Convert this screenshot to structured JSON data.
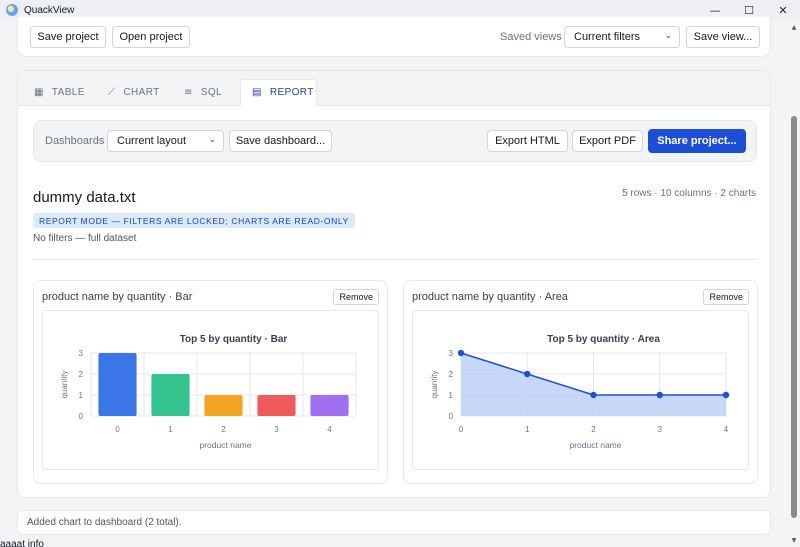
{
  "window": {
    "title": "QuackView",
    "controls": [
      "—",
      "☐",
      "✕"
    ]
  },
  "toolbar": {
    "save_project": "Save project",
    "open_project": "Open project",
    "saved_views_label": "Saved views",
    "saved_views_value": "Current filters",
    "save_view": "Save view..."
  },
  "tabs": [
    {
      "label": "TABLE",
      "icon": "table-icon",
      "glyph": "▦"
    },
    {
      "label": "CHART",
      "icon": "line-chart-icon",
      "glyph": "⟋"
    },
    {
      "label": "SQL",
      "icon": "code-lines-icon",
      "glyph": "≡"
    },
    {
      "label": "REPORT",
      "icon": "document-icon",
      "glyph": "▤"
    }
  ],
  "active_tab": "REPORT",
  "dashboard": {
    "label": "Dashboards",
    "layout_value": "Current layout",
    "save_dashboard": "Save dashboard...",
    "export_html": "Export HTML",
    "export_pdf": "Export PDF",
    "share": "Share project..."
  },
  "report": {
    "title": "dummy data.txt",
    "meta": "5 rows · 10 columns · 2 charts",
    "badge": "REPORT MODE — FILTERS ARE LOCKED; CHARTS ARE READ-ONLY",
    "filters": "No filters — full dataset"
  },
  "cards": [
    {
      "title": "product name by quantity · Bar",
      "remove": "Remove"
    },
    {
      "title": "product name by quantity · Area",
      "remove": "Remove"
    }
  ],
  "chart_data": [
    {
      "type": "bar",
      "title": "Top 5 by quantity · Bar",
      "xlabel": "product name",
      "ylabel": "quantity",
      "categories": [
        "0",
        "1",
        "2",
        "3",
        "4"
      ],
      "values": [
        3,
        2,
        1,
        1,
        1
      ],
      "ylim": [
        0,
        3
      ],
      "yticks": [
        "0",
        "1",
        "2",
        "3"
      ],
      "grid": true,
      "colors": [
        "#3b76e6",
        "#34c38f",
        "#f5a524",
        "#ef5b5b",
        "#a070f0"
      ]
    },
    {
      "type": "area",
      "title": "Top 5 by quantity · Area",
      "xlabel": "product name",
      "ylabel": "quantity",
      "x": [
        "0",
        "1",
        "2",
        "3",
        "4"
      ],
      "values": [
        3,
        2,
        1,
        1,
        1
      ],
      "ylim": [
        0,
        3
      ],
      "yticks": [
        "0",
        "1",
        "2",
        "3"
      ],
      "grid": true,
      "color": "#1d4ed8",
      "fill": "#bcd0f7"
    }
  ],
  "status": "Added chart to dashboard (2 total).",
  "footer_fragment": "aaaat info",
  "colors": {
    "accent": "#1d4ed8",
    "badge_bg": "#dbeafe",
    "badge_text": "#1e40af"
  }
}
